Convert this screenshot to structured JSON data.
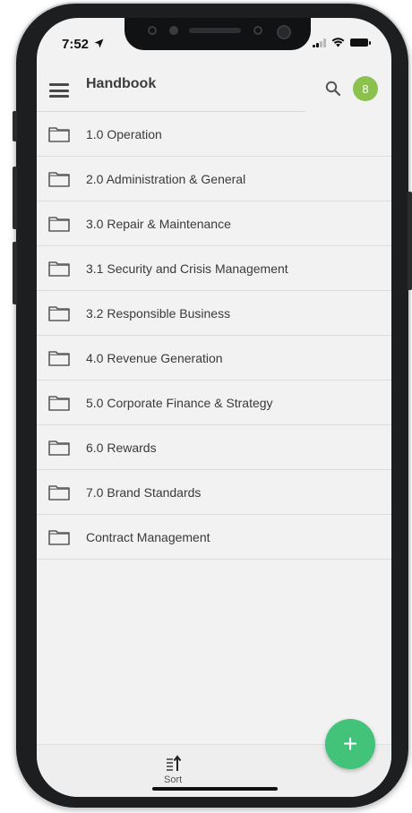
{
  "status_bar": {
    "time": "7:52"
  },
  "app_bar": {
    "title": "Handbook",
    "avatar_initial": "8",
    "avatar_color": "#8cc04f"
  },
  "folders": [
    {
      "label": "1.0 Operation"
    },
    {
      "label": "2.0 Administration & General"
    },
    {
      "label": "3.0 Repair & Maintenance"
    },
    {
      "label": "3.1 Security and Crisis Management"
    },
    {
      "label": "3.2 Responsible Business"
    },
    {
      "label": "4.0 Revenue Generation"
    },
    {
      "label": "5.0 Corporate Finance & Strategy"
    },
    {
      "label": "6.0 Rewards"
    },
    {
      "label": "7.0 Brand Standards"
    },
    {
      "label": "Contract Management"
    }
  ],
  "bottom_bar": {
    "sort_label": "Sort"
  },
  "fab": {
    "label": "+",
    "color": "#43c27a"
  },
  "icons": {
    "menu": "hamburger-menu-icon",
    "search": "search-icon",
    "folder": "folder-icon",
    "sort": "sort-icon",
    "location": "location-arrow-icon",
    "signal": "signal-icon",
    "wifi": "wifi-icon",
    "battery": "battery-icon"
  }
}
